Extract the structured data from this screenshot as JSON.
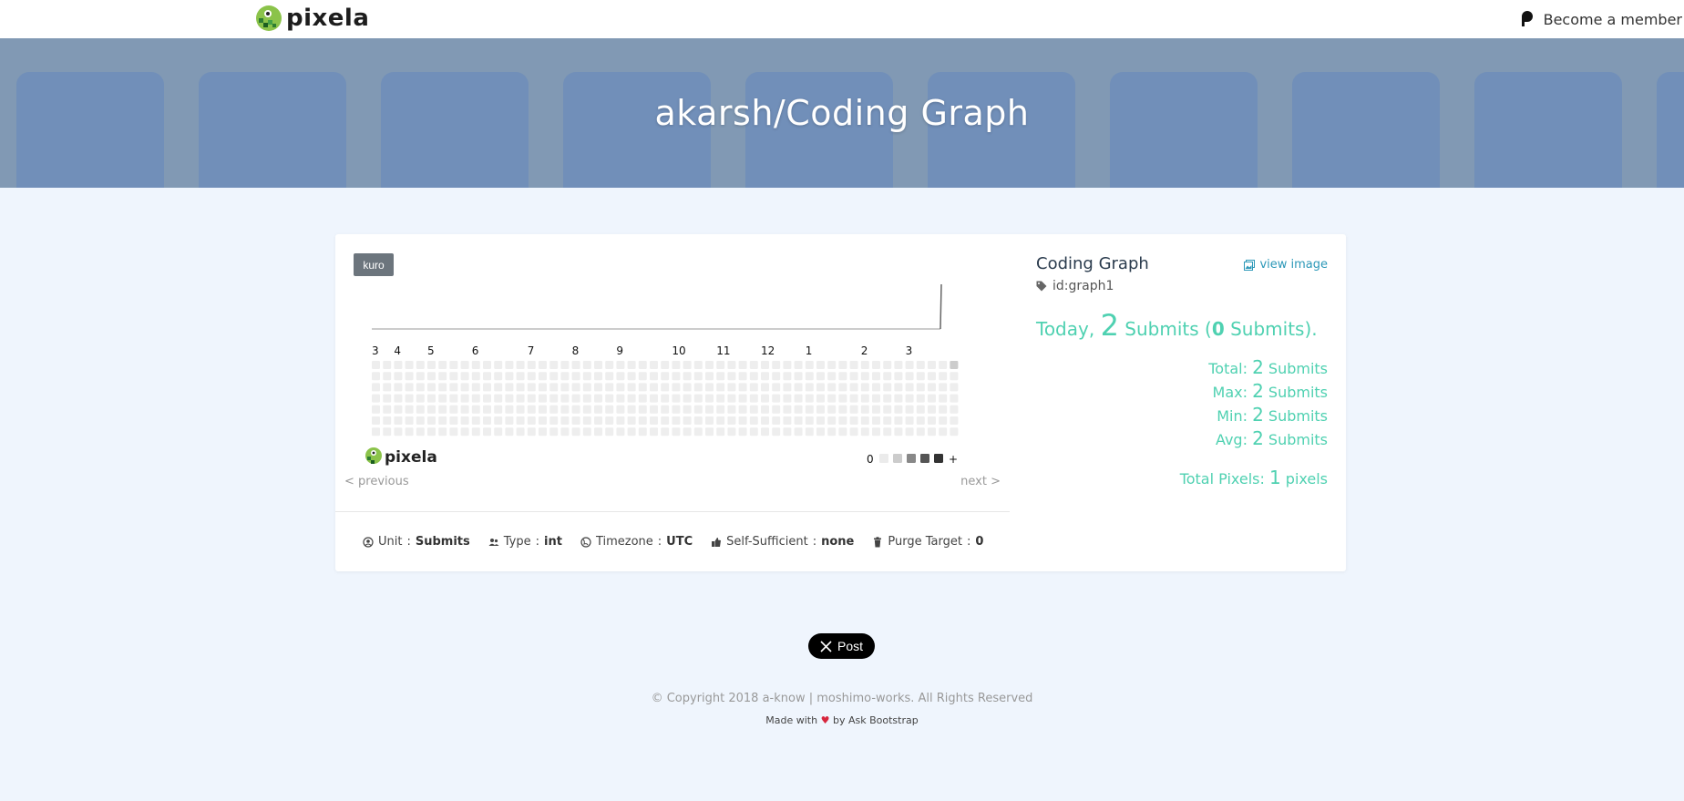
{
  "nav": {
    "brand": "pixela",
    "member_label": "Become a member"
  },
  "hero": {
    "title": "akarsh/Coding Graph"
  },
  "graph": {
    "theme_button": "kuro",
    "month_labels": [
      "3",
      "4",
      "5",
      "6",
      "7",
      "8",
      "9",
      "10",
      "11",
      "12",
      "1",
      "2",
      "3"
    ],
    "weeks": 53,
    "days_per_week": 7,
    "active_pixel": {
      "week": 53,
      "day": 1,
      "quantity": 2
    },
    "logo_text": "pixela",
    "legend_min": "0",
    "legend_max": "+",
    "legend_colors": [
      "#ebebeb",
      "#cccccc",
      "#888888",
      "#555555",
      "#333333"
    ],
    "empty_color": "#eeeeee",
    "active_color": "#cccccc",
    "prev_label": "< previous",
    "next_label": "next >"
  },
  "meta": {
    "unit_label": "Unit",
    "unit_value": "Submits",
    "type_label": "Type",
    "type_value": "int",
    "timezone_label": "Timezone",
    "timezone_value": "UTC",
    "self_label": "Self-Sufficient",
    "self_value": "none",
    "purge_label": "Purge Target",
    "purge_value": "0"
  },
  "summary": {
    "graph_name": "Coding Graph",
    "view_image": "view image",
    "graph_id": "id:graph1",
    "today_prefix": "Today",
    "today_comma": ",",
    "today_value": "2",
    "today_unit": "Submits",
    "today_delta_open": "(",
    "today_delta": "0",
    "today_delta_unit": "Submits).",
    "stats": [
      {
        "label": "Total:",
        "value": "2",
        "unit": "Submits"
      },
      {
        "label": "Max:",
        "value": "2",
        "unit": "Submits"
      },
      {
        "label": "Min:",
        "value": "2",
        "unit": "Submits"
      },
      {
        "label": "Avg:",
        "value": "2",
        "unit": "Submits"
      }
    ],
    "pixels_label": "Total Pixels:",
    "pixels_value": "1",
    "pixels_unit": "pixels"
  },
  "footer": {
    "post_label": "Post",
    "copyright": "© Copyright 2018 a-know | moshimo-works. All Rights Reserved",
    "made_with": "Made with",
    "made_by": "by Ask Bootstrap"
  },
  "colors": {
    "accent": "#4fd1b1",
    "link": "#2c98b8",
    "background": "#eff5fd"
  }
}
